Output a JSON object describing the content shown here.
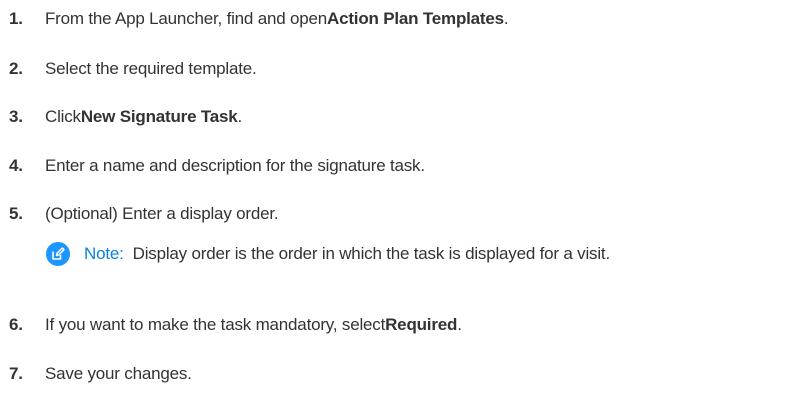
{
  "steps": [
    {
      "number": "1.",
      "before": "From the App Launcher, find and open ",
      "bold": "Action Plan Templates",
      "after": "."
    },
    {
      "number": "2.",
      "before": "Select the required template.",
      "bold": "",
      "after": ""
    },
    {
      "number": "3.",
      "before": "Click ",
      "bold": "New Signature Task",
      "after": "."
    },
    {
      "number": "4.",
      "before": "Enter a name and description for the signature task.",
      "bold": "",
      "after": ""
    },
    {
      "number": "5.",
      "before": "(Optional) Enter a display order.",
      "bold": "",
      "after": ""
    },
    {
      "number": "6.",
      "before": "If you want to make the task mandatory, select ",
      "bold": "Required",
      "after": "."
    },
    {
      "number": "7.",
      "before": "Save your changes.",
      "bold": "",
      "after": ""
    }
  ],
  "note": {
    "icon": "edit-icon",
    "label": "Note:",
    "text": "Display order is the order in which the task is displayed for a visit."
  },
  "colors": {
    "note_icon": "#1b96ff",
    "note_label": "#0b82d9",
    "text": "#333333"
  }
}
